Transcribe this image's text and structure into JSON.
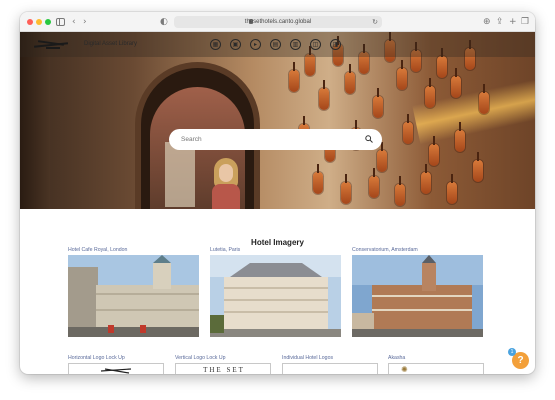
{
  "browser": {
    "url": "thesethotels.canto.global",
    "reload_icon": "↻"
  },
  "nav": {
    "title": "Digital Asset Library",
    "icons": [
      "grid-icon",
      "image-icon",
      "play-icon",
      "document-icon",
      "archive-icon",
      "cart-icon",
      "lightbox-icon"
    ]
  },
  "search": {
    "placeholder": "Search"
  },
  "section": {
    "title": "Hotel Imagery"
  },
  "cards": [
    {
      "label": "Hotel Cafe Royal, London"
    },
    {
      "label": "Lutetia, Paris"
    },
    {
      "label": "Conservatorium, Amsterdam"
    }
  ],
  "bottom_cards": [
    {
      "label": "Horizontal Logo Lock Up"
    },
    {
      "label": "Vertical Logo Lock Up",
      "text": "THE SET"
    },
    {
      "label": "Individual Hotel Logos"
    },
    {
      "label": "Akasha"
    }
  ],
  "help": {
    "label": "?",
    "badge": "1"
  },
  "colors": {
    "accent": "#f3a03a",
    "badge": "#4aa3df",
    "label_link": "#5a6a9a"
  }
}
